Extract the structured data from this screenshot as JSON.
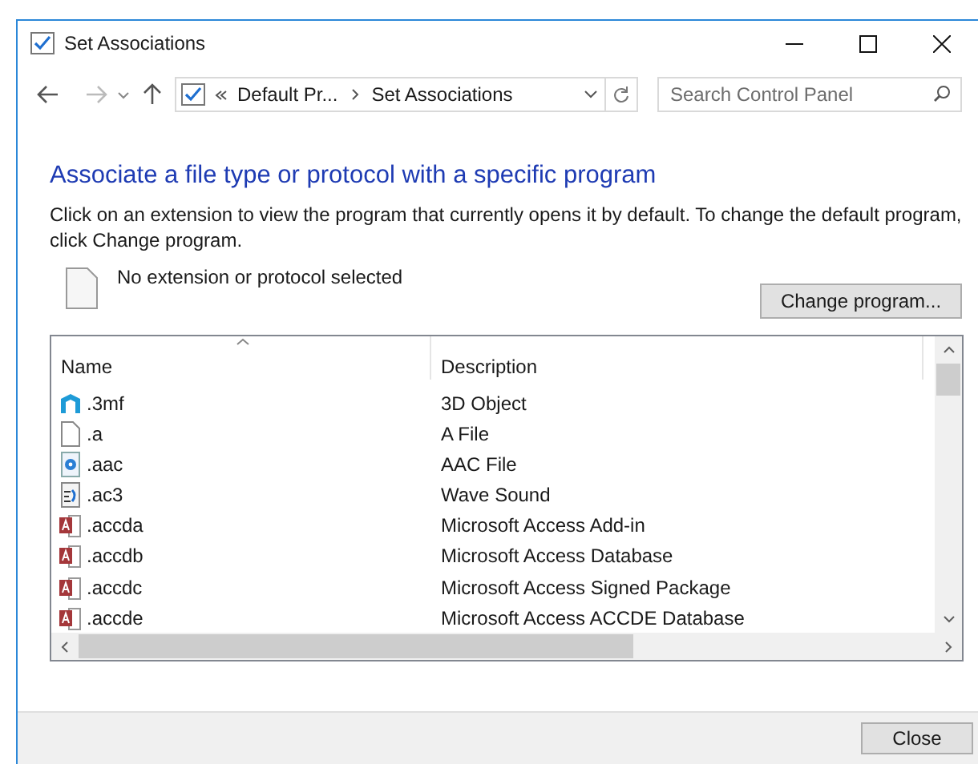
{
  "window": {
    "title": "Set Associations"
  },
  "address_bar": {
    "segments": [
      "Default Pr...",
      "Set Associations"
    ]
  },
  "search": {
    "placeholder": "Search Control Panel"
  },
  "heading": "Associate a file type or protocol with a specific program",
  "description": "Click on an extension to view the program that currently opens it by default. To change the default program, click Change program.",
  "current": {
    "label": "No extension or protocol selected"
  },
  "change_button": "Change program...",
  "table": {
    "columns": [
      "Name",
      "Description"
    ],
    "rows": [
      {
        "kind": "model",
        "name": ".3mf",
        "description": "3D Object"
      },
      {
        "kind": "blank",
        "name": ".a",
        "description": "A File"
      },
      {
        "kind": "audio",
        "name": ".aac",
        "description": "AAC File"
      },
      {
        "kind": "wave",
        "name": ".ac3",
        "description": "Wave Sound"
      },
      {
        "kind": "access",
        "name": ".accda",
        "description": "Microsoft Access Add-in"
      },
      {
        "kind": "access",
        "name": ".accdb",
        "description": "Microsoft Access Database"
      },
      {
        "kind": "access",
        "name": ".accdc",
        "description": "Microsoft Access Signed Package"
      },
      {
        "kind": "access",
        "name": ".accde",
        "description": "Microsoft Access ACCDE Database"
      }
    ]
  },
  "close_button": "Close"
}
